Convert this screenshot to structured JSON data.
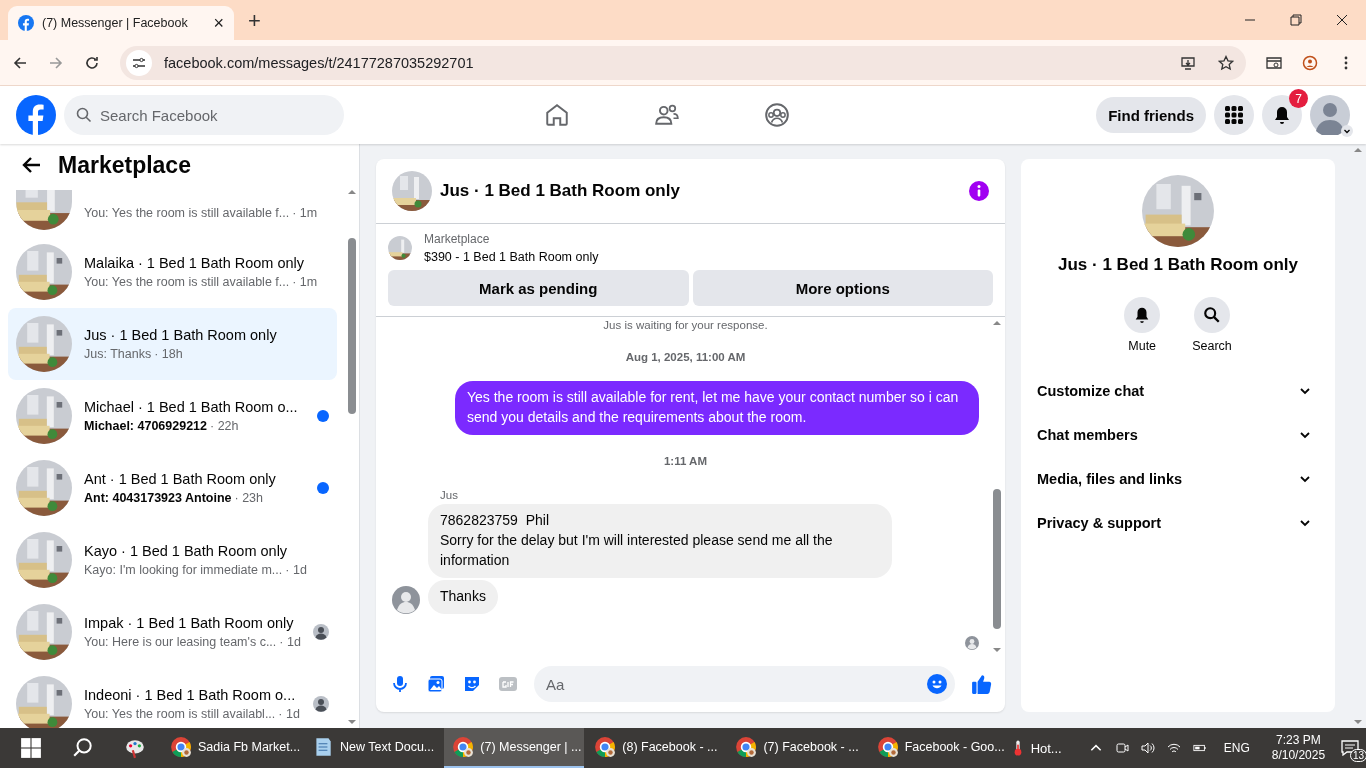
{
  "browser": {
    "tab_title": "(7) Messenger | Facebook",
    "tab_close": "×",
    "new_tab": "+",
    "url": "facebook.com/messages/t/24177287035292701"
  },
  "header": {
    "search_placeholder": "Search Facebook",
    "find_friends": "Find friends",
    "notification_count": "7"
  },
  "sidebar": {
    "title": "Marketplace",
    "conversations": [
      {
        "preview": "You: Yes the room is still available f...",
        "time": "· 1m",
        "unread": false,
        "selected": false,
        "seen": false,
        "partial": true
      },
      {
        "name": "Malaika · 1 Bed 1 Bath Room only",
        "preview": "You: Yes the room is still available f...",
        "time": "· 1m",
        "unread": false,
        "selected": false,
        "seen": false
      },
      {
        "name": "Jus · 1 Bed 1 Bath Room only",
        "preview": "Jus: Thanks",
        "time": "· 18h",
        "unread": false,
        "selected": true,
        "seen": false
      },
      {
        "name": "Michael · 1 Bed 1 Bath Room o...",
        "preview": "Michael: 4706929212",
        "time": "· 22h",
        "unread": true,
        "selected": false,
        "seen": false
      },
      {
        "name": "Ant · 1 Bed 1 Bath Room only",
        "preview": "Ant: 4043173923 Antoine",
        "time": "· 23h",
        "unread": true,
        "selected": false,
        "seen": false
      },
      {
        "name": "Kayo · 1 Bed 1 Bath Room only",
        "preview": "Kayo: I'm looking for immediate m...",
        "time": "· 1d",
        "unread": false,
        "selected": false,
        "seen": false
      },
      {
        "name": "Impak · 1 Bed 1 Bath Room only",
        "preview": "You: Here is our leasing team's c...",
        "time": "· 1d",
        "unread": false,
        "selected": false,
        "seen": true
      },
      {
        "name": "Indeoni · 1 Bed 1 Bath Room o...",
        "preview": "You: Yes the room is still availabl...",
        "time": "· 1d",
        "unread": false,
        "selected": false,
        "seen": true
      }
    ]
  },
  "chat": {
    "title": "Jus · 1 Bed 1 Bath Room only",
    "listing": {
      "label": "Marketplace",
      "text": "$390 - 1 Bed 1 Bath Room only"
    },
    "actions": [
      "Mark as pending",
      "More options"
    ],
    "notice": "Jus is waiting for your response.",
    "messages": [
      {
        "kind": "timestamp",
        "text": "Aug 1, 2025, 11:00 AM"
      },
      {
        "kind": "outgoing",
        "text": "Yes the room is still available for rent, let me have your contact number so i can send you details and the requirements about the room."
      },
      {
        "kind": "timestamp",
        "text": "1:11 AM"
      },
      {
        "kind": "sender",
        "text": "Jus"
      },
      {
        "kind": "incoming",
        "text": "7862823759  Phil\nSorry for the delay but I'm will interested please send me all the information",
        "avatar": false
      },
      {
        "kind": "incoming",
        "text": "Thanks",
        "avatar": true
      }
    ],
    "composer_placeholder": "Aa"
  },
  "details": {
    "title": "Jus · 1 Bed 1 Bath Room only",
    "actions": [
      {
        "kind": "bell",
        "label": "Mute"
      },
      {
        "kind": "search",
        "label": "Search"
      }
    ],
    "sections": [
      {
        "label": "Customize chat",
        "expanded": false
      },
      {
        "label": "Chat members",
        "expanded": false
      },
      {
        "label": "Media, files and links",
        "expanded": false
      },
      {
        "label": "Privacy & support",
        "expanded": false
      }
    ]
  },
  "taskbar": {
    "apps": [
      {
        "kind": "chrome",
        "label": "Sadia Fb Market...",
        "selected": false
      },
      {
        "kind": "notepad",
        "label": "New Text Docu...",
        "selected": false
      },
      {
        "kind": "chrome",
        "label": "(7) Messenger | ...",
        "selected": true
      },
      {
        "kind": "chrome",
        "label": "(8) Facebook - ...",
        "selected": false
      },
      {
        "kind": "chrome",
        "label": "(7) Facebook - ...",
        "selected": false
      },
      {
        "kind": "chrome",
        "label": "Facebook - Goo...",
        "selected": false
      }
    ],
    "weather": "Hot...",
    "language": "ENG",
    "time": "7:23 PM",
    "date": "8/10/2025",
    "notifications": "13"
  }
}
